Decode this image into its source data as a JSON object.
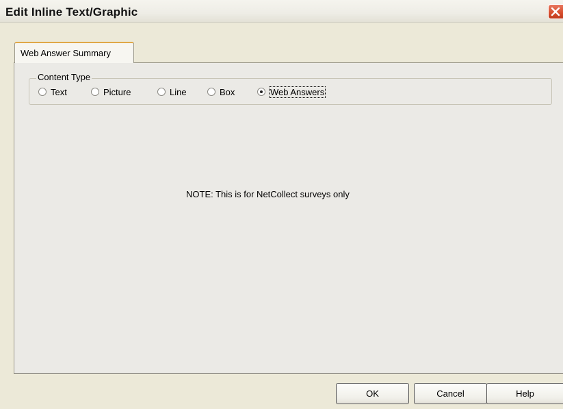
{
  "window": {
    "title": "Edit Inline Text/Graphic",
    "close_icon": "close-icon"
  },
  "tabs": [
    {
      "label": "Web Answer Summary",
      "selected": true
    }
  ],
  "content_type": {
    "legend": "Content Type",
    "options": [
      {
        "label": "Text",
        "checked": false
      },
      {
        "label": "Picture",
        "checked": false
      },
      {
        "label": "Line",
        "checked": false
      },
      {
        "label": "Box",
        "checked": false
      },
      {
        "label": "Web Answers",
        "checked": true
      }
    ]
  },
  "note": "NOTE:  This is for NetCollect surveys only",
  "buttons": {
    "ok": "OK",
    "cancel": "Cancel",
    "help": "Help"
  },
  "colors": {
    "close_button": "#d9502f",
    "tab_highlight": "#e0a848",
    "dialog_bg": "#ece9d8"
  }
}
